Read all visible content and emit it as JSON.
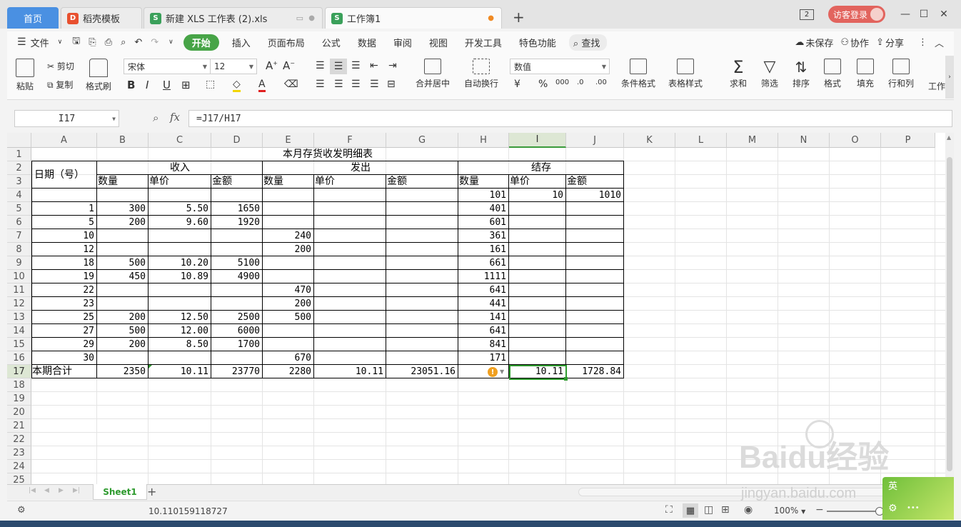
{
  "tabs": [
    {
      "label": "首页"
    },
    {
      "label": "稻壳模板"
    },
    {
      "label": "新建 XLS 工作表 (2).xls"
    },
    {
      "label": "工作簿1"
    }
  ],
  "title_bar": {
    "badge": "2",
    "login": "访客登录"
  },
  "menu": {
    "file": "文件",
    "items": [
      "开始",
      "插入",
      "页面布局",
      "公式",
      "数据",
      "审阅",
      "视图",
      "开发工具",
      "特色功能"
    ],
    "search": "查找",
    "unsaved": "未保存",
    "collab": "协作",
    "share": "分享"
  },
  "ribbon": {
    "paste": "粘贴",
    "cut": "剪切",
    "copy": "复制",
    "format_painter": "格式刷",
    "font_name": "宋体",
    "font_size": "12",
    "merge": "合并居中",
    "wrap": "自动换行",
    "number_format": "数值",
    "cond_format": "条件格式",
    "table_style": "表格样式",
    "sum": "求和",
    "filter": "筛选",
    "sort": "排序",
    "format": "格式",
    "fill": "填充",
    "rowcol": "行和列",
    "worksheet": "工作"
  },
  "formula_bar": {
    "cell_ref": "I17",
    "fx": "fx",
    "formula": "=J17/H17"
  },
  "columns": [
    "A",
    "B",
    "C",
    "D",
    "E",
    "F",
    "G",
    "H",
    "I",
    "J",
    "K",
    "L",
    "M",
    "N",
    "O",
    "P"
  ],
  "selected_column": "I",
  "rows": [
    "1",
    "2",
    "3",
    "4",
    "5",
    "6",
    "7",
    "8",
    "9",
    "10",
    "11",
    "12",
    "13",
    "14",
    "15",
    "16",
    "17",
    "18",
    "19",
    "20",
    "21",
    "22",
    "23",
    "24",
    "25"
  ],
  "selected_row": "17",
  "sheet": {
    "title": "本月存货收发明细表",
    "date_header": "日期（号）",
    "group_in": "收入",
    "group_out": "发出",
    "group_bal": "结存",
    "sub_qty": "数量",
    "sub_price": "单价",
    "sub_amt": "金额",
    "data_rows": [
      {
        "a": "",
        "b": "",
        "c": "",
        "d": "",
        "e": "",
        "f": "",
        "g": "",
        "h": "101",
        "i": "10",
        "j": "1010"
      },
      {
        "a": "1",
        "b": "300",
        "c": "5.50",
        "d": "1650",
        "e": "",
        "f": "",
        "g": "",
        "h": "401",
        "i": "",
        "j": ""
      },
      {
        "a": "5",
        "b": "200",
        "c": "9.60",
        "d": "1920",
        "e": "",
        "f": "",
        "g": "",
        "h": "601",
        "i": "",
        "j": ""
      },
      {
        "a": "10",
        "b": "",
        "c": "",
        "d": "",
        "e": "240",
        "f": "",
        "g": "",
        "h": "361",
        "i": "",
        "j": ""
      },
      {
        "a": "12",
        "b": "",
        "c": "",
        "d": "",
        "e": "200",
        "f": "",
        "g": "",
        "h": "161",
        "i": "",
        "j": ""
      },
      {
        "a": "18",
        "b": "500",
        "c": "10.20",
        "d": "5100",
        "e": "",
        "f": "",
        "g": "",
        "h": "661",
        "i": "",
        "j": ""
      },
      {
        "a": "19",
        "b": "450",
        "c": "10.89",
        "d": "4900",
        "e": "",
        "f": "",
        "g": "",
        "h": "1111",
        "i": "",
        "j": ""
      },
      {
        "a": "22",
        "b": "",
        "c": "",
        "d": "",
        "e": "470",
        "f": "",
        "g": "",
        "h": "641",
        "i": "",
        "j": ""
      },
      {
        "a": "23",
        "b": "",
        "c": "",
        "d": "",
        "e": "200",
        "f": "",
        "g": "",
        "h": "441",
        "i": "",
        "j": ""
      },
      {
        "a": "25",
        "b": "200",
        "c": "12.50",
        "d": "2500",
        "e": "500",
        "f": "",
        "g": "",
        "h": "141",
        "i": "",
        "j": ""
      },
      {
        "a": "27",
        "b": "500",
        "c": "12.00",
        "d": "6000",
        "e": "",
        "f": "",
        "g": "",
        "h": "641",
        "i": "",
        "j": ""
      },
      {
        "a": "29",
        "b": "200",
        "c": "8.50",
        "d": "1700",
        "e": "",
        "f": "",
        "g": "",
        "h": "841",
        "i": "",
        "j": ""
      },
      {
        "a": "30",
        "b": "",
        "c": "",
        "d": "",
        "e": "670",
        "f": "",
        "g": "",
        "h": "171",
        "i": "",
        "j": ""
      }
    ],
    "total_row": {
      "a": "本期合计",
      "b": "2350",
      "c": "10.11",
      "d": "23770",
      "e": "2280",
      "f": "10.11",
      "g": "23051.16",
      "h": "",
      "i": "10.11",
      "j": "1728.84"
    }
  },
  "sheet_tab": "Sheet1",
  "status": {
    "value": "10.110159118727",
    "zoom": "100%"
  },
  "watermark": "Baidu经验",
  "watermark_url": "jingyan.baidu.com",
  "ime": "英"
}
